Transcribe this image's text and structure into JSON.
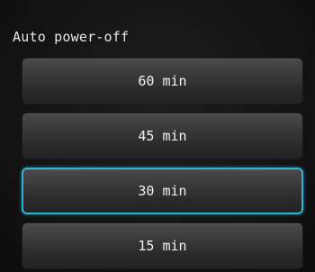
{
  "screen": {
    "title": "Auto power-off"
  },
  "options": [
    {
      "label": "60 min",
      "selected": false
    },
    {
      "label": "45 min",
      "selected": false
    },
    {
      "label": "30 min",
      "selected": true
    },
    {
      "label": "15 min",
      "selected": false
    }
  ],
  "colors": {
    "selection_outline": "#2bb3d6",
    "background": "#141414",
    "text": "#f2f2f2"
  }
}
